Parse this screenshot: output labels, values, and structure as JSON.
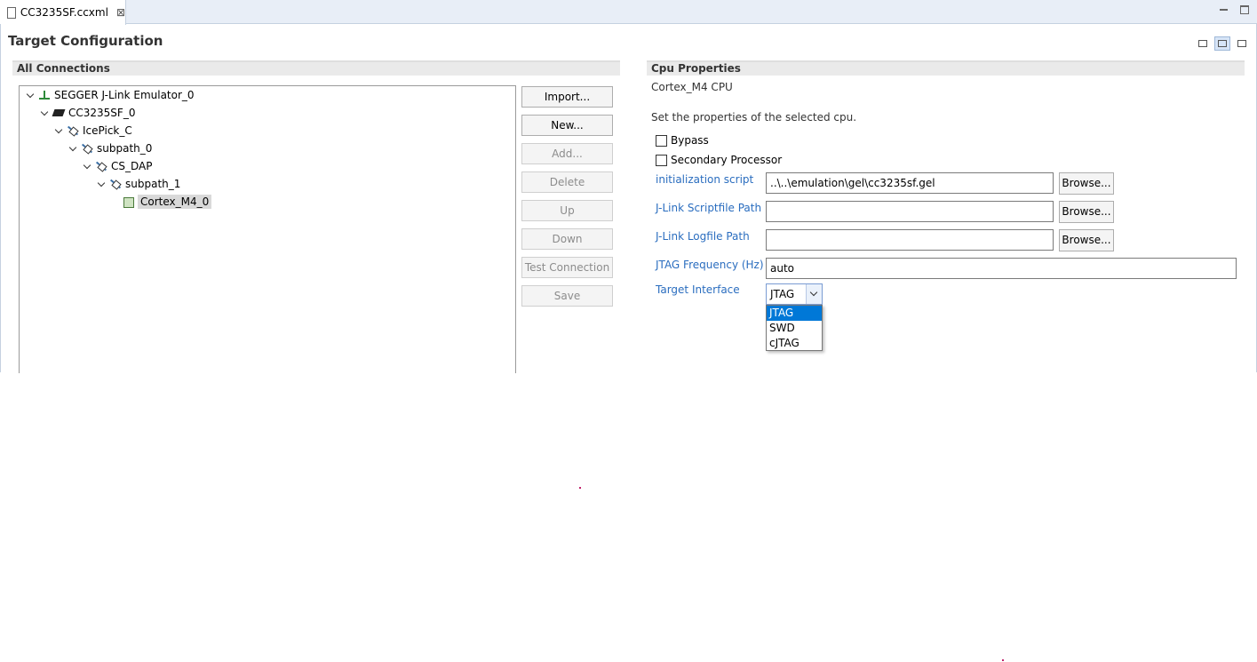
{
  "tab": {
    "title": "CC3235SF.ccxml",
    "close": "⊠"
  },
  "page": {
    "title": "Target Configuration"
  },
  "connections": {
    "heading": "All Connections",
    "tree": [
      {
        "label": "SEGGER J-Link Emulator_0",
        "icon": "emulator-icon"
      },
      {
        "label": "CC3235SF_0",
        "icon": "chip-icon"
      },
      {
        "label": "IcePick_C",
        "icon": "router-icon"
      },
      {
        "label": "subpath_0",
        "icon": "path-icon"
      },
      {
        "label": "CS_DAP",
        "icon": "router-icon"
      },
      {
        "label": "subpath_1",
        "icon": "path-icon"
      },
      {
        "label": "Cortex_M4_0",
        "icon": "cpu-icon"
      }
    ],
    "buttons": {
      "import": "Import...",
      "new": "New...",
      "add": "Add...",
      "delete": "Delete",
      "up": "Up",
      "down": "Down",
      "test": "Test Connection",
      "save": "Save"
    }
  },
  "cpu": {
    "heading": "Cpu Properties",
    "name": "Cortex_M4 CPU",
    "description": "Set the properties of the selected cpu.",
    "bypass": "Bypass",
    "secondary": "Secondary Processor",
    "init_label": "initialization script",
    "init_value": "..\\..\\emulation\\gel\\cc3235sf.gel",
    "scriptfile_label": "J-Link Scriptfile Path",
    "scriptfile_value": "",
    "logfile_label": "J-Link Logfile Path",
    "logfile_value": "",
    "browse": "Browse...",
    "freq_label": "JTAG Frequency (Hz)",
    "freq_value": "auto",
    "interface_label": "Target Interface",
    "interface_value": "JTAG",
    "interface_options": [
      "JTAG",
      "SWD",
      "cJTAG"
    ]
  }
}
